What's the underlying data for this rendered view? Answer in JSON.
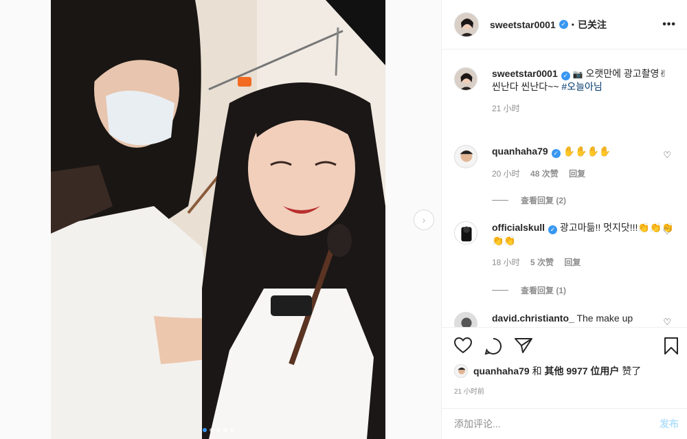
{
  "post": {
    "username": "sweetstar0001",
    "follow_state": "已关注",
    "more_label": "•••",
    "caption_line1": "오랫만에 광고촬영",
    "caption_line2": "씬난다 씬난다~~",
    "caption_tag": "#오늘아님",
    "caption_time": "21 小时"
  },
  "comments": [
    {
      "username": "quanhaha79",
      "text": "✋✋✋✋",
      "time": "20 小时",
      "likes": "48 次赞",
      "reply": "回复",
      "view_replies": "查看回复 (2)"
    },
    {
      "username": "officialskull",
      "text": "광고마듦!! 멋지닷!!!👏👏👏👏👏",
      "time": "18 小时",
      "likes": "5 次赞",
      "reply": "回复",
      "view_replies": "查看回复 (1)"
    },
    {
      "username": "david.christianto_",
      "text": "The make up"
    }
  ],
  "likes_row": {
    "user": "quanhaha79",
    "and": "和",
    "others": "其他 9977 位用户",
    "liked": "赞了"
  },
  "post_time": "21 小时前",
  "comment_input": {
    "placeholder": "添加评论...",
    "post_label": "发布"
  },
  "carousel": {
    "count": 5,
    "active_index": 0
  },
  "colors": {
    "accent": "#3897f0",
    "post_disabled": "#b2dffc"
  }
}
